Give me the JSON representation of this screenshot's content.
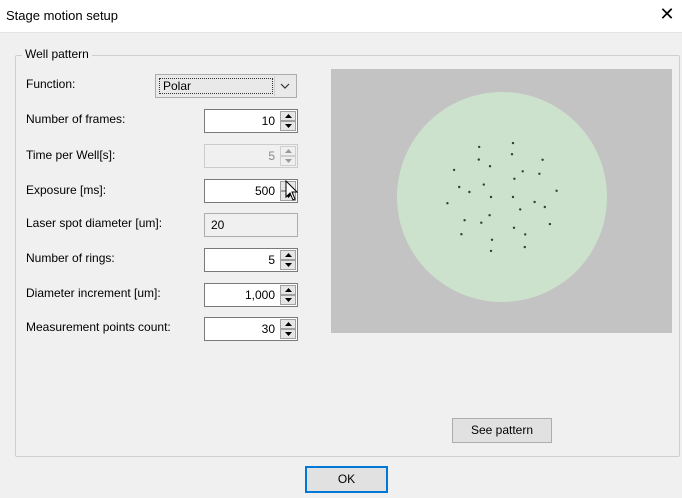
{
  "window": {
    "title": "Stage motion setup",
    "close_glyph": "✕"
  },
  "group": {
    "title": "Well pattern"
  },
  "fields": {
    "function": {
      "label": "Function:",
      "value": "Polar"
    },
    "frames": {
      "label": "Number of frames:",
      "value": "10"
    },
    "time_per_well": {
      "label": "Time per Well[s]:",
      "value": "5",
      "disabled": true
    },
    "exposure": {
      "label": "Exposure [ms]:",
      "value": "500"
    },
    "laser_spot": {
      "label": "Laser spot diameter [um]:",
      "value": "20"
    },
    "rings": {
      "label": "Number of rings:",
      "value": "5"
    },
    "diameter_increment": {
      "label": "Diameter increment [um]:",
      "value": "1,000"
    },
    "points_count": {
      "label": "Measurement points count:",
      "value": "30"
    }
  },
  "preview": {
    "background_color": "#c3c3c3",
    "well_color": "#cce2cc",
    "point_color": "#3a3a3a",
    "point_count": 30
  },
  "buttons": {
    "see_pattern": "See pattern",
    "ok": "OK"
  },
  "icons": {
    "close": "close-icon",
    "dropdown": "chevron-down-icon",
    "cursor": "mouse-cursor-icon"
  }
}
